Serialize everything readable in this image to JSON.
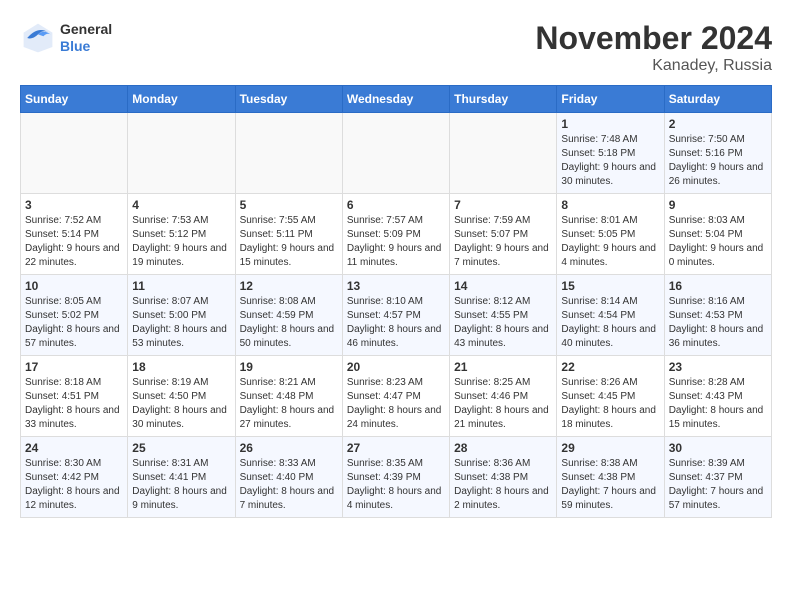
{
  "header": {
    "logo_general": "General",
    "logo_blue": "Blue",
    "month_title": "November 2024",
    "location": "Kanadey, Russia"
  },
  "weekdays": [
    "Sunday",
    "Monday",
    "Tuesday",
    "Wednesday",
    "Thursday",
    "Friday",
    "Saturday"
  ],
  "weeks": [
    [
      {
        "day": "",
        "info": ""
      },
      {
        "day": "",
        "info": ""
      },
      {
        "day": "",
        "info": ""
      },
      {
        "day": "",
        "info": ""
      },
      {
        "day": "",
        "info": ""
      },
      {
        "day": "1",
        "info": "Sunrise: 7:48 AM\nSunset: 5:18 PM\nDaylight: 9 hours and 30 minutes."
      },
      {
        "day": "2",
        "info": "Sunrise: 7:50 AM\nSunset: 5:16 PM\nDaylight: 9 hours and 26 minutes."
      }
    ],
    [
      {
        "day": "3",
        "info": "Sunrise: 7:52 AM\nSunset: 5:14 PM\nDaylight: 9 hours and 22 minutes."
      },
      {
        "day": "4",
        "info": "Sunrise: 7:53 AM\nSunset: 5:12 PM\nDaylight: 9 hours and 19 minutes."
      },
      {
        "day": "5",
        "info": "Sunrise: 7:55 AM\nSunset: 5:11 PM\nDaylight: 9 hours and 15 minutes."
      },
      {
        "day": "6",
        "info": "Sunrise: 7:57 AM\nSunset: 5:09 PM\nDaylight: 9 hours and 11 minutes."
      },
      {
        "day": "7",
        "info": "Sunrise: 7:59 AM\nSunset: 5:07 PM\nDaylight: 9 hours and 7 minutes."
      },
      {
        "day": "8",
        "info": "Sunrise: 8:01 AM\nSunset: 5:05 PM\nDaylight: 9 hours and 4 minutes."
      },
      {
        "day": "9",
        "info": "Sunrise: 8:03 AM\nSunset: 5:04 PM\nDaylight: 9 hours and 0 minutes."
      }
    ],
    [
      {
        "day": "10",
        "info": "Sunrise: 8:05 AM\nSunset: 5:02 PM\nDaylight: 8 hours and 57 minutes."
      },
      {
        "day": "11",
        "info": "Sunrise: 8:07 AM\nSunset: 5:00 PM\nDaylight: 8 hours and 53 minutes."
      },
      {
        "day": "12",
        "info": "Sunrise: 8:08 AM\nSunset: 4:59 PM\nDaylight: 8 hours and 50 minutes."
      },
      {
        "day": "13",
        "info": "Sunrise: 8:10 AM\nSunset: 4:57 PM\nDaylight: 8 hours and 46 minutes."
      },
      {
        "day": "14",
        "info": "Sunrise: 8:12 AM\nSunset: 4:55 PM\nDaylight: 8 hours and 43 minutes."
      },
      {
        "day": "15",
        "info": "Sunrise: 8:14 AM\nSunset: 4:54 PM\nDaylight: 8 hours and 40 minutes."
      },
      {
        "day": "16",
        "info": "Sunrise: 8:16 AM\nSunset: 4:53 PM\nDaylight: 8 hours and 36 minutes."
      }
    ],
    [
      {
        "day": "17",
        "info": "Sunrise: 8:18 AM\nSunset: 4:51 PM\nDaylight: 8 hours and 33 minutes."
      },
      {
        "day": "18",
        "info": "Sunrise: 8:19 AM\nSunset: 4:50 PM\nDaylight: 8 hours and 30 minutes."
      },
      {
        "day": "19",
        "info": "Sunrise: 8:21 AM\nSunset: 4:48 PM\nDaylight: 8 hours and 27 minutes."
      },
      {
        "day": "20",
        "info": "Sunrise: 8:23 AM\nSunset: 4:47 PM\nDaylight: 8 hours and 24 minutes."
      },
      {
        "day": "21",
        "info": "Sunrise: 8:25 AM\nSunset: 4:46 PM\nDaylight: 8 hours and 21 minutes."
      },
      {
        "day": "22",
        "info": "Sunrise: 8:26 AM\nSunset: 4:45 PM\nDaylight: 8 hours and 18 minutes."
      },
      {
        "day": "23",
        "info": "Sunrise: 8:28 AM\nSunset: 4:43 PM\nDaylight: 8 hours and 15 minutes."
      }
    ],
    [
      {
        "day": "24",
        "info": "Sunrise: 8:30 AM\nSunset: 4:42 PM\nDaylight: 8 hours and 12 minutes."
      },
      {
        "day": "25",
        "info": "Sunrise: 8:31 AM\nSunset: 4:41 PM\nDaylight: 8 hours and 9 minutes."
      },
      {
        "day": "26",
        "info": "Sunrise: 8:33 AM\nSunset: 4:40 PM\nDaylight: 8 hours and 7 minutes."
      },
      {
        "day": "27",
        "info": "Sunrise: 8:35 AM\nSunset: 4:39 PM\nDaylight: 8 hours and 4 minutes."
      },
      {
        "day": "28",
        "info": "Sunrise: 8:36 AM\nSunset: 4:38 PM\nDaylight: 8 hours and 2 minutes."
      },
      {
        "day": "29",
        "info": "Sunrise: 8:38 AM\nSunset: 4:38 PM\nDaylight: 7 hours and 59 minutes."
      },
      {
        "day": "30",
        "info": "Sunrise: 8:39 AM\nSunset: 4:37 PM\nDaylight: 7 hours and 57 minutes."
      }
    ]
  ],
  "accent_color": "#3a7bd5"
}
